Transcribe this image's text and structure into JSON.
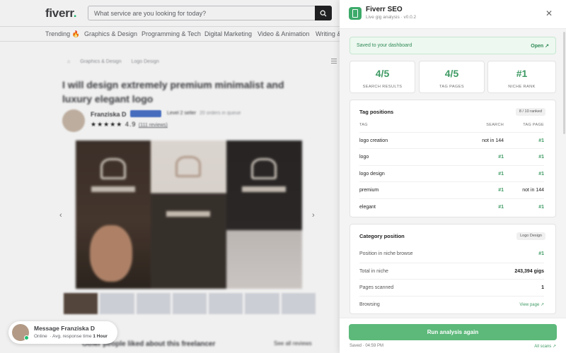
{
  "fiverr": {
    "logo": "fiverr",
    "logo_dot": ".",
    "search_placeholder": "What service are you looking for today?",
    "nav": [
      "Trending 🔥",
      "Graphics & Design",
      "Programming & Tech",
      "Digital Marketing",
      "Video & Animation",
      "Writing &"
    ],
    "breadcrumb": [
      "⌂",
      "Graphics & Design",
      "Logo Design"
    ],
    "gig_title": "I will design extremely premium minimalist and luxury elegant logo",
    "seller": {
      "name": "Franziska D",
      "level": "Level 2 seller",
      "orders": "20 orders in queue",
      "stars": "★★★★★ 4.9",
      "reviews": "(111 reviews)"
    },
    "bottom_heading": "Other people liked about this freelancer",
    "see_all": "See all reviews",
    "message": {
      "title": "Message Franziska D",
      "status": "Online",
      "response_label": "· Avg. response time",
      "response_value": "1 Hour"
    }
  },
  "panel": {
    "title": "Fiverr SEO",
    "subtitle": "Live gig analysis · v0.0.2",
    "saved_text": "Saved to your dashboard",
    "saved_action": "Open ↗",
    "stats": [
      {
        "value": "4/5",
        "label": "SEARCH RESULTS"
      },
      {
        "value": "4/5",
        "label": "TAG PAGES"
      },
      {
        "value": "#1",
        "label": "NICHE RANK"
      }
    ],
    "tag_positions": {
      "title": "Tag positions",
      "chip": "8 / 10 ranked",
      "columns": [
        "TAG",
        "SEARCH",
        "TAG PAGE"
      ],
      "rows": [
        {
          "tag": "logo creation",
          "search": "not in 144",
          "tag_page": "#1"
        },
        {
          "tag": "logo",
          "search": "#1",
          "tag_page": "#1"
        },
        {
          "tag": "logo design",
          "search": "#1",
          "tag_page": "#1"
        },
        {
          "tag": "premium",
          "search": "#1",
          "tag_page": "not in 144"
        },
        {
          "tag": "elegant",
          "search": "#1",
          "tag_page": "#1"
        }
      ]
    },
    "category": {
      "title": "Category position",
      "chip": "Logo Design",
      "rows": [
        {
          "label": "Position in niche browse",
          "value": "#1"
        },
        {
          "label": "Total in niche",
          "value": "243,394 gigs"
        },
        {
          "label": "Pages scanned",
          "value": "1"
        },
        {
          "label": "Browsing",
          "value": "View page ↗"
        }
      ]
    },
    "run_button": "Run analysis again",
    "footer_left": "Saved · 04:59 PM",
    "footer_right": "All scans ↗",
    "accent": "#3d9a63"
  }
}
